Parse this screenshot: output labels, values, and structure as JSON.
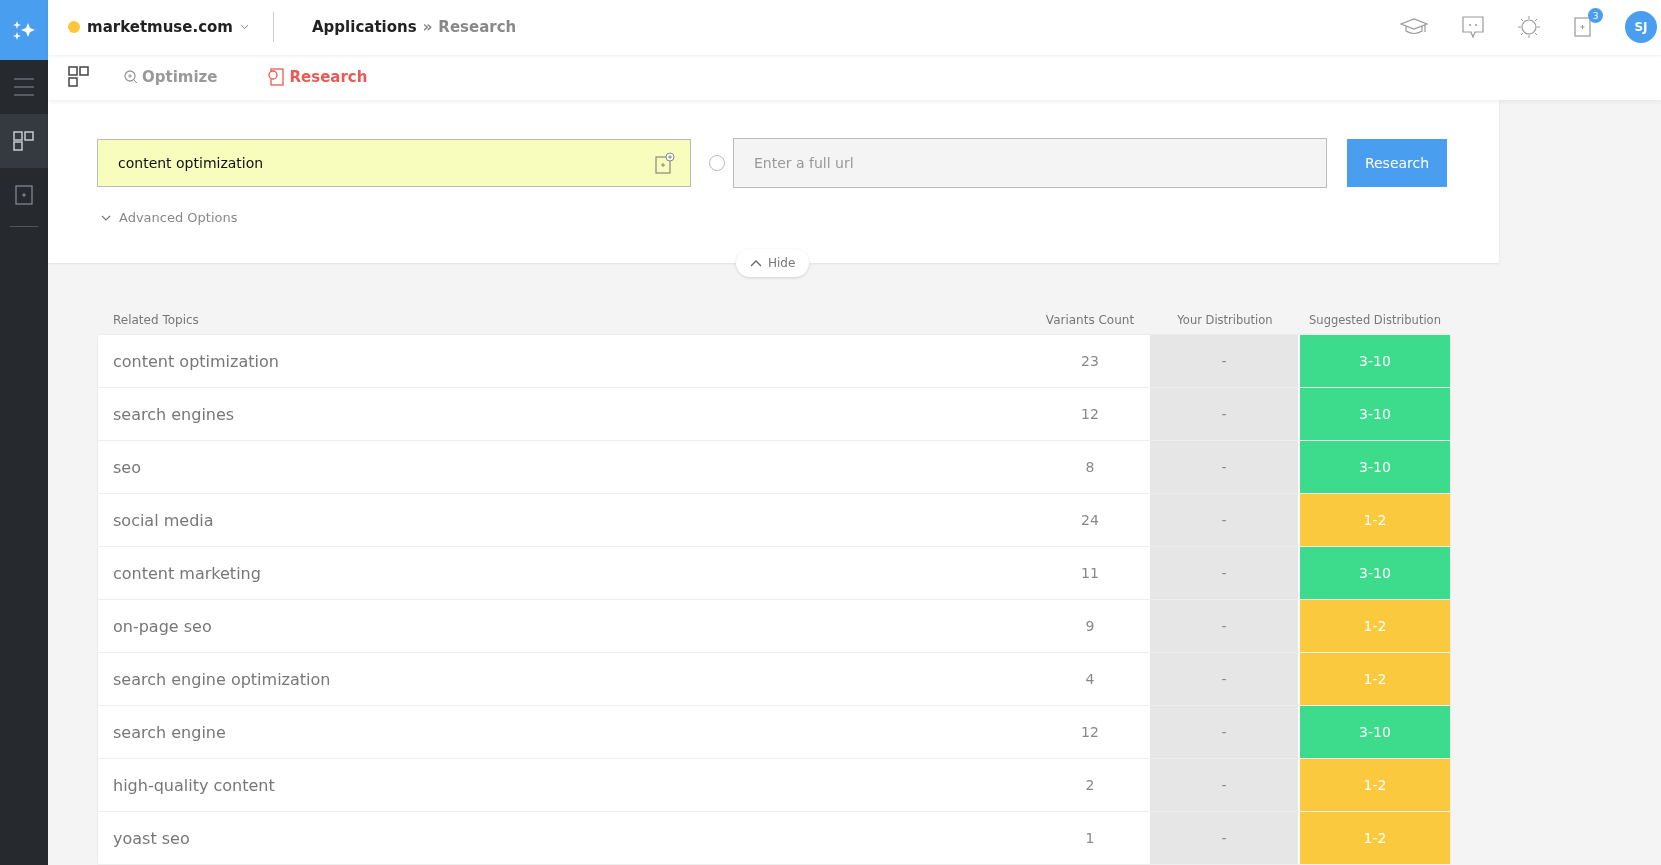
{
  "header": {
    "domain": "marketmuse.com",
    "breadcrumb": {
      "root": "Applications",
      "separator": "»",
      "current": "Research"
    },
    "notification_count": "3",
    "avatar_initials": "SJ"
  },
  "tabs": [
    {
      "label": "Optimize",
      "selected": false
    },
    {
      "label": "Research",
      "selected": true
    }
  ],
  "search": {
    "topic_value": "content optimization",
    "url_placeholder": "Enter a full url",
    "url_selected": false,
    "button": "Research",
    "advanced_options": "Advanced Options",
    "hide": "Hide"
  },
  "table": {
    "columns": [
      "Related Topics",
      "Variants Count",
      "Your Distribution",
      "Suggested Distribution"
    ],
    "rows": [
      {
        "topic": "content optimization",
        "variants": "23",
        "yours": "-",
        "suggested": "3-10",
        "color": "#3ddc8c"
      },
      {
        "topic": "search engines",
        "variants": "12",
        "yours": "-",
        "suggested": "3-10",
        "color": "#3ddc8c"
      },
      {
        "topic": "seo",
        "variants": "8",
        "yours": "-",
        "suggested": "3-10",
        "color": "#3ddc8c"
      },
      {
        "topic": "social media",
        "variants": "24",
        "yours": "-",
        "suggested": "1-2",
        "color": "#fbc93d"
      },
      {
        "topic": "content marketing",
        "variants": "11",
        "yours": "-",
        "suggested": "3-10",
        "color": "#3ddc8c"
      },
      {
        "topic": "on-page seo",
        "variants": "9",
        "yours": "-",
        "suggested": "1-2",
        "color": "#fbc93d"
      },
      {
        "topic": "search engine optimization",
        "variants": "4",
        "yours": "-",
        "suggested": "1-2",
        "color": "#fbc93d"
      },
      {
        "topic": "search engine",
        "variants": "12",
        "yours": "-",
        "suggested": "3-10",
        "color": "#3ddc8c"
      },
      {
        "topic": "high-quality content",
        "variants": "2",
        "yours": "-",
        "suggested": "1-2",
        "color": "#fbc93d"
      },
      {
        "topic": "yoast seo",
        "variants": "1",
        "yours": "-",
        "suggested": "1-2",
        "color": "#fbc93d"
      }
    ]
  }
}
